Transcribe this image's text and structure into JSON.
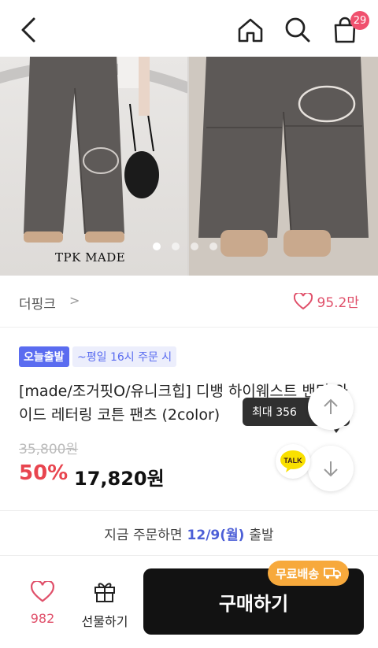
{
  "header": {
    "back_icon": "chevron-left-icon",
    "home_icon": "home-icon",
    "search_icon": "search-icon",
    "cart_icon": "shopping-bag-icon",
    "cart_count": "29"
  },
  "gallery": {
    "image_label": "TPK MADE",
    "page_count": 4,
    "active_page": 1,
    "expand_icon": "expand-icon"
  },
  "brand": {
    "name": "더핑크",
    "chevron": ">",
    "like_icon": "heart-icon",
    "like_count": "95.2만"
  },
  "badges": {
    "today": "오늘출발",
    "weekday": "~평일 16시 주문 시"
  },
  "product": {
    "title": "[made/조거핏O/유니크힙] 디뱅 하이웨스트 밴딩 와이드 레터링 코튼 팬츠 (2color)",
    "original_price": "35,800원",
    "discount": "50%",
    "price": "17,820원"
  },
  "tooltip": {
    "text": "최대 356"
  },
  "talk": {
    "label": "TALK"
  },
  "shipping": {
    "prefix": "지금 주문하면",
    "date": "12/9(월)",
    "suffix": "출발"
  },
  "bottom": {
    "like_count": "982",
    "gift_label": "선물하기",
    "buy_label": "구매하기",
    "free_ship_label": "무료배송"
  },
  "colors": {
    "accent_red": "#e8454f",
    "accent_blue": "#5a6cf0",
    "free_ship": "#f7a93c",
    "buy_button": "#121212"
  }
}
